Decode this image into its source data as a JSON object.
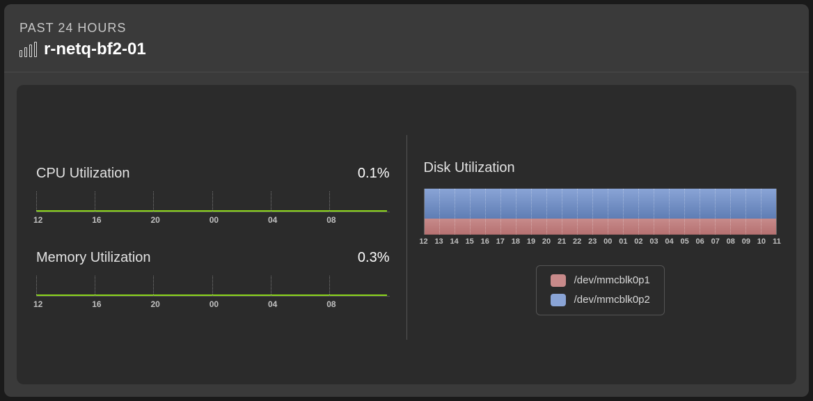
{
  "header": {
    "timespan": "PAST 24 HOURS",
    "host": "r-netq-bf2-01"
  },
  "cpu": {
    "label": "CPU Utilization",
    "value": "0.1%"
  },
  "memory": {
    "label": "Memory Utilization",
    "value": "0.3%"
  },
  "disk": {
    "label": "Disk Utilization"
  },
  "legend": {
    "item1": "/dev/mmcblk0p1",
    "item2": "/dev/mmcblk0p2"
  },
  "axis": {
    "small": [
      "12",
      "16",
      "20",
      "00",
      "04",
      "08"
    ],
    "disk": [
      "12",
      "13",
      "14",
      "15",
      "16",
      "17",
      "18",
      "19",
      "20",
      "21",
      "22",
      "23",
      "00",
      "01",
      "02",
      "03",
      "04",
      "05",
      "06",
      "07",
      "08",
      "09",
      "10",
      "11"
    ]
  },
  "chart_data": [
    {
      "type": "line",
      "title": "CPU Utilization",
      "ylabel": "%",
      "ylim": [
        0,
        100
      ],
      "categories": [
        "12",
        "16",
        "20",
        "00",
        "04",
        "08"
      ],
      "values": [
        0.1,
        0.1,
        0.1,
        0.1,
        0.1,
        0.1
      ]
    },
    {
      "type": "line",
      "title": "Memory Utilization",
      "ylabel": "%",
      "ylim": [
        0,
        100
      ],
      "categories": [
        "12",
        "16",
        "20",
        "00",
        "04",
        "08"
      ],
      "values": [
        0.3,
        0.3,
        0.3,
        0.3,
        0.3,
        0.3
      ]
    },
    {
      "type": "area",
      "title": "Disk Utilization",
      "ylabel": "%",
      "ylim": [
        0,
        100
      ],
      "categories": [
        "12",
        "13",
        "14",
        "15",
        "16",
        "17",
        "18",
        "19",
        "20",
        "21",
        "22",
        "23",
        "00",
        "01",
        "02",
        "03",
        "04",
        "05",
        "06",
        "07",
        "08",
        "09",
        "10",
        "11"
      ],
      "series": [
        {
          "name": "/dev/mmcblk0p1",
          "values": [
            34,
            34,
            34,
            34,
            34,
            34,
            34,
            34,
            34,
            34,
            34,
            34,
            34,
            34,
            34,
            34,
            34,
            34,
            34,
            34,
            34,
            34,
            34,
            34
          ]
        },
        {
          "name": "/dev/mmcblk0p2",
          "values": [
            66,
            66,
            66,
            66,
            66,
            66,
            66,
            66,
            66,
            66,
            66,
            66,
            66,
            66,
            66,
            66,
            66,
            66,
            66,
            66,
            66,
            66,
            66,
            66
          ]
        }
      ]
    }
  ]
}
